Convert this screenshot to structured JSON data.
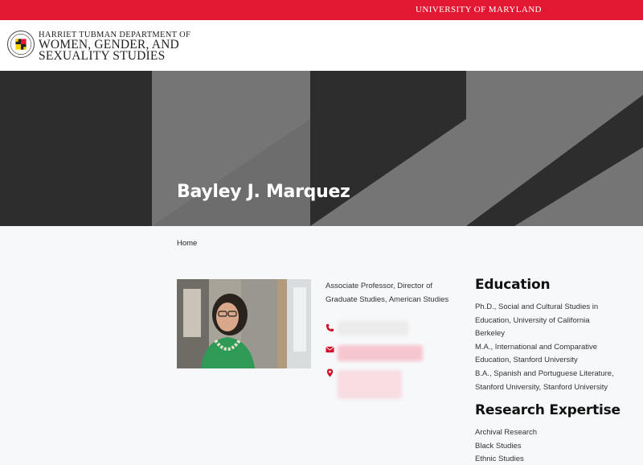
{
  "utility": {
    "label": "UNIVERSITY OF MARYLAND"
  },
  "header": {
    "line1": "HARRIET TUBMAN DEPARTMENT OF",
    "line2": "WOMEN, GENDER, AND",
    "line3": "SEXUALITY STUDIES",
    "logo_icon": "umd-seal-icon"
  },
  "hero": {
    "name": "Bayley J. Marquez"
  },
  "breadcrumb": {
    "home": "Home"
  },
  "profile": {
    "title": "Associate Professor, Director of Graduate Studies, American Studies",
    "icons": [
      "phone-icon",
      "envelope-icon",
      "map-marker-icon"
    ]
  },
  "education": {
    "heading": "Education",
    "lines": [
      "Ph.D., Social and Cultural Studies in",
      "Education, University of California",
      "Berkeley",
      "M.A., International and Comparative",
      "Education, Stanford University",
      "B.A., Spanish and Portuguese Literature,",
      "Stanford University, Stanford University"
    ]
  },
  "research": {
    "heading": "Research Expertise",
    "items": [
      "Archival Research",
      "Black Studies",
      "Ethnic Studies"
    ]
  },
  "colors": {
    "brand_red": "#e21833",
    "hero_dark": "#2d2d2d",
    "hero_gray": "#757575"
  }
}
